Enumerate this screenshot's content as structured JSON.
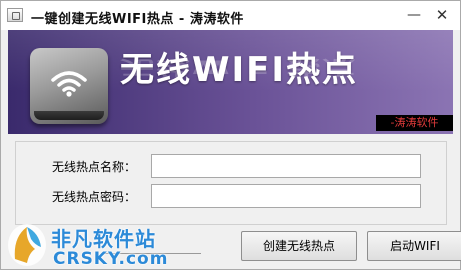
{
  "window": {
    "title": "一键创建无线WIFI热点 - 涛涛软件",
    "minimize_glyph": "—",
    "close_glyph": "✕"
  },
  "banner": {
    "title": "无线WIFI热点",
    "brand_tag": "-涛涛软件",
    "icon": "wifi-router-icon",
    "colors": {
      "bg_start": "#3a2a6c",
      "bg_end": "#8b74b3",
      "brand_tag_text": "#e23b3b"
    }
  },
  "form": {
    "ssid_label": "无线热点名称：",
    "ssid_value": "",
    "password_label": "无线热点密码：",
    "password_value": ""
  },
  "buttons": {
    "create_label": "创建无线热点",
    "start_label": "启动WIFI"
  },
  "watermark": {
    "cn_text": "非凡软件站",
    "en_text": "CRSKY.com"
  }
}
